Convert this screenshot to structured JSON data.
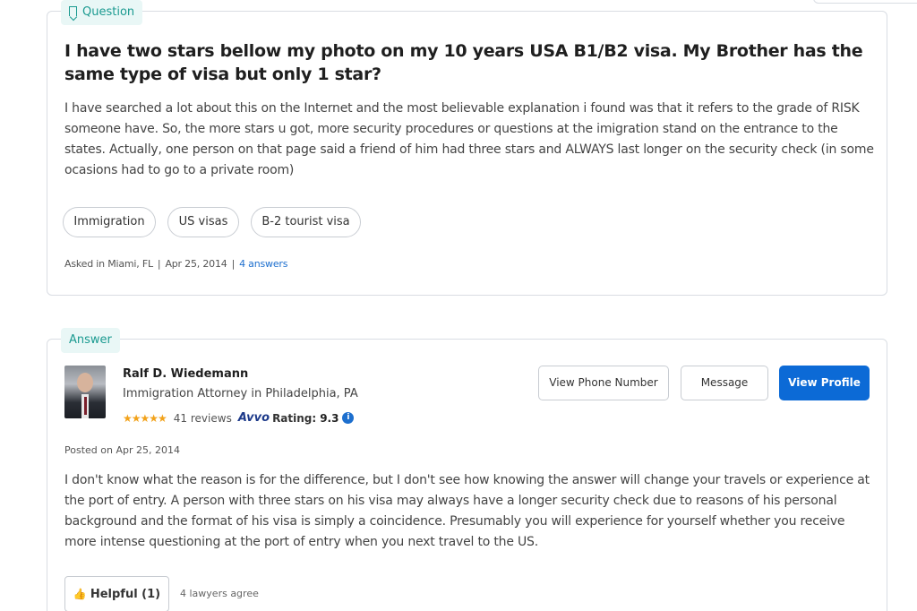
{
  "question": {
    "badge": "Question",
    "title": "I have two stars bellow my photo on my 10 years USA B1/B2 visa. My Brother has the same type of visa but only 1 star?",
    "body": "I have searched a lot about this on the Internet and the most believable explanation i found was that it refers to the grade of RISK someone have. So, the more stars u got, more security procedures or questions at the imigration stand on the entrance to the states. Actually, one person on that page said a friend of him had three stars and ALWAYS last longer on the security check (in some ocasions had to go to a private room)",
    "tags": [
      "Immigration",
      "US visas",
      "B-2 tourist visa"
    ],
    "meta": {
      "location": "Asked in Miami, FL",
      "date": "Apr 25, 2014",
      "answers": "4 answers"
    }
  },
  "answer": {
    "badge": "Answer",
    "lawyer": {
      "name": "Ralf D. Wiedemann",
      "title": "Immigration Attorney in Philadelphia, PA",
      "stars": "★★★★★",
      "reviews": "41 reviews",
      "avvo": "Avvo",
      "rating_label": "Rating:",
      "rating": "9.3",
      "info_icon": "i"
    },
    "buttons": {
      "phone": "View Phone Number",
      "message": "Message",
      "profile": "View Profile"
    },
    "posted": "Posted on Apr 25, 2014",
    "body": "I don't know what the reason is for the difference, but I don't see how knowing the answer will change your travels or experience at the port of entry. A person with three stars on his visa may always have a longer security check due to reasons of his personal background and the format of his visa is simply a coincidence. Presumably you will experience for yourself whether you receive more intense questioning at the port of entry when you next travel to the US.",
    "helpful_label": "Helpful (1)",
    "agree": "4 lawyers agree"
  },
  "icons": {
    "bookmark": "bookmark-icon",
    "thumbs_up": "thumbs-up-icon",
    "info": "info-icon",
    "star": "star-icon"
  },
  "colors": {
    "accent": "#1a9a90",
    "badge_bg": "#e9f7f6",
    "primary": "#0c6ad6",
    "link": "#1d6fce",
    "star": "#f2a21a"
  }
}
